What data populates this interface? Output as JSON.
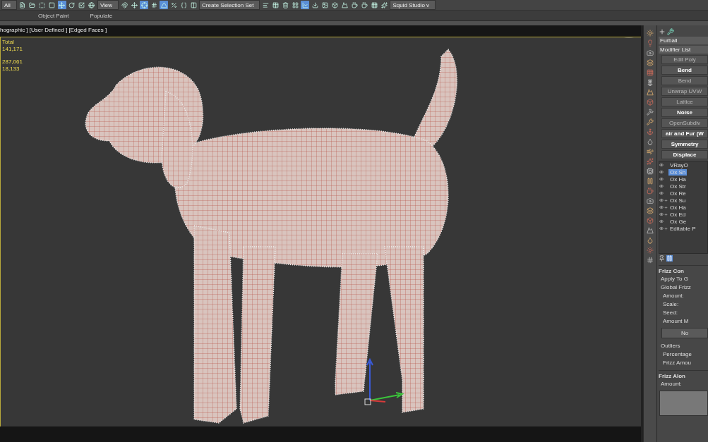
{
  "toolbar": [
    {
      "kind": "dropdown",
      "label": "All"
    },
    {
      "kind": "icon",
      "selected": false
    },
    {
      "kind": "icon",
      "selected": false
    },
    {
      "kind": "icon",
      "selected": false
    },
    {
      "kind": "icon",
      "selected": false
    },
    {
      "kind": "icon",
      "selected": true
    },
    {
      "kind": "icon",
      "selected": false
    },
    {
      "kind": "icon",
      "selected": false
    },
    {
      "kind": "icon",
      "selected": false
    },
    {
      "kind": "dropdown",
      "label": "View"
    },
    {
      "kind": "icon",
      "selected": false
    },
    {
      "kind": "icon",
      "selected": false
    },
    {
      "kind": "icon",
      "selected": true
    },
    {
      "kind": "icon",
      "selected": false
    },
    {
      "kind": "icon",
      "selected": true
    },
    {
      "kind": "icon",
      "selected": false
    },
    {
      "kind": "icon",
      "selected": false
    },
    {
      "kind": "icon",
      "selected": false
    },
    {
      "kind": "dropdown",
      "label": "Create Selection Set"
    },
    {
      "kind": "icon",
      "selected": false
    },
    {
      "kind": "icon",
      "selected": false
    },
    {
      "kind": "icon",
      "selected": false
    },
    {
      "kind": "icon",
      "selected": false
    },
    {
      "kind": "icon",
      "selected": true
    },
    {
      "kind": "icon",
      "selected": false
    },
    {
      "kind": "icon",
      "selected": false
    },
    {
      "kind": "icon",
      "selected": false
    },
    {
      "kind": "icon",
      "selected": false
    },
    {
      "kind": "icon",
      "selected": false
    },
    {
      "kind": "icon",
      "selected": false
    },
    {
      "kind": "icon",
      "selected": false
    },
    {
      "kind": "icon",
      "selected": false
    },
    {
      "kind": "dropdown",
      "label": "Squid Studio v"
    }
  ],
  "ribbon_tabs": [
    {
      "label": "Object Paint"
    },
    {
      "label": "Populate"
    }
  ],
  "viewport": {
    "label": "hographic ] [User Defined ] [Edged Faces ]",
    "stats": [
      "Total",
      "141,171",
      "287,061",
      "18,133"
    ]
  },
  "command_panel": {
    "object_name": "Furball",
    "modifier_list": "Modifier List",
    "modifier_buttons": [
      {
        "label": "Edit Poly",
        "disabled": true
      },
      {
        "label": "Bend",
        "disabled": false
      },
      {
        "label": "Bend",
        "disabled": true
      },
      {
        "label": "Unwrap UVW",
        "disabled": true
      },
      {
        "label": "Lattice",
        "disabled": true
      },
      {
        "label": "Noise",
        "disabled": false
      },
      {
        "label": "OpenSubdiv",
        "disabled": true
      },
      {
        "label": "air and Fur (W",
        "disabled": false
      },
      {
        "label": "Symmetry",
        "disabled": false
      },
      {
        "label": "Displace",
        "disabled": false
      }
    ],
    "stack": [
      {
        "label": "VRayO",
        "selected": false,
        "collapsed": false
      },
      {
        "label": "Ox Sh",
        "selected": true,
        "collapsed": false
      },
      {
        "label": "Ox Ha",
        "selected": false,
        "collapsed": false
      },
      {
        "label": "Ox Str",
        "selected": false,
        "collapsed": false
      },
      {
        "label": "Ox Re",
        "selected": false,
        "collapsed": false
      },
      {
        "label": "Ox Su",
        "selected": false,
        "collapsed": true
      },
      {
        "label": "Ox Ha",
        "selected": false,
        "collapsed": true
      },
      {
        "label": "Ox Ed",
        "selected": false,
        "collapsed": true
      },
      {
        "label": "Ox Ge",
        "selected": false,
        "collapsed": false
      },
      {
        "label": "Editable P",
        "selected": false,
        "collapsed": true
      }
    ],
    "rollouts": [
      {
        "title": "Frizz Con",
        "items": [
          {
            "kind": "label",
            "text": "Apply To G"
          },
          {
            "kind": "label",
            "text": "Global Frizz"
          },
          {
            "kind": "field",
            "text": "Amount:"
          },
          {
            "kind": "field",
            "text": "Scale:"
          },
          {
            "kind": "field",
            "text": "Seed:"
          },
          {
            "kind": "field",
            "text": "Amount M"
          },
          {
            "kind": "button",
            "text": "No"
          },
          {
            "kind": "label",
            "text": "Outliers"
          },
          {
            "kind": "field",
            "text": "Percentage"
          },
          {
            "kind": "field",
            "text": "Frizz Amou"
          }
        ]
      },
      {
        "title": "Frizz Alon",
        "items": [
          {
            "kind": "label",
            "text": "Amount:"
          },
          {
            "kind": "curve"
          }
        ]
      }
    ]
  }
}
